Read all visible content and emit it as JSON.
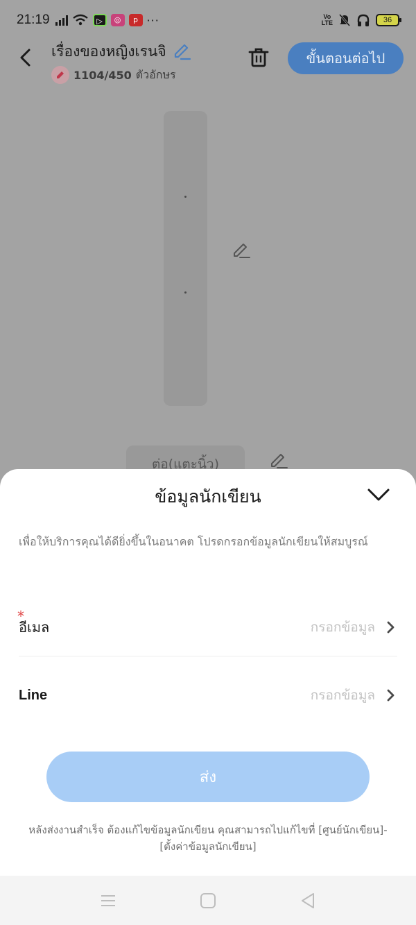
{
  "status_bar": {
    "time": "21:19",
    "dots": "···",
    "battery": "36",
    "volte_top": "Vo",
    "volte_bottom": "LTE"
  },
  "header": {
    "title": "เรื่องของหญิงเรนจิ",
    "char_count": "1104/450",
    "char_unit": "ตัวอักษร",
    "next_label": "ขั้นตอนต่อไป"
  },
  "content": {
    "continue_label": "ต่อ(แตะนิ้ว)"
  },
  "sheet": {
    "title": "ข้อมูลนักเขียน",
    "description": "เพื่อให้บริการคุณได้ดียิ่งขึ้นในอนาคต โปรดกรอกข้อมูลนักเขียนให้สมบูรณ์",
    "fields": [
      {
        "label": "อีเมล",
        "required_mark": "*",
        "placeholder": "กรอกข้อมูล"
      },
      {
        "label": "Line",
        "placeholder": "กรอกข้อมูล"
      }
    ],
    "submit_label": "ส่ง",
    "footnote": "หลังส่งงานสำเร็จ ต้องแก้ไขข้อมูลนักเขียน คุณสามารถไปแก้ไขที่ [ศูนย์นักเขียน]-[ตั้งค่าข้อมูลนักเขียน]"
  },
  "colors": {
    "overlay": "#a3a3a3",
    "accent": "#4a7fc0",
    "submit_disabled": "#a8cdf6",
    "required": "#e04848"
  }
}
